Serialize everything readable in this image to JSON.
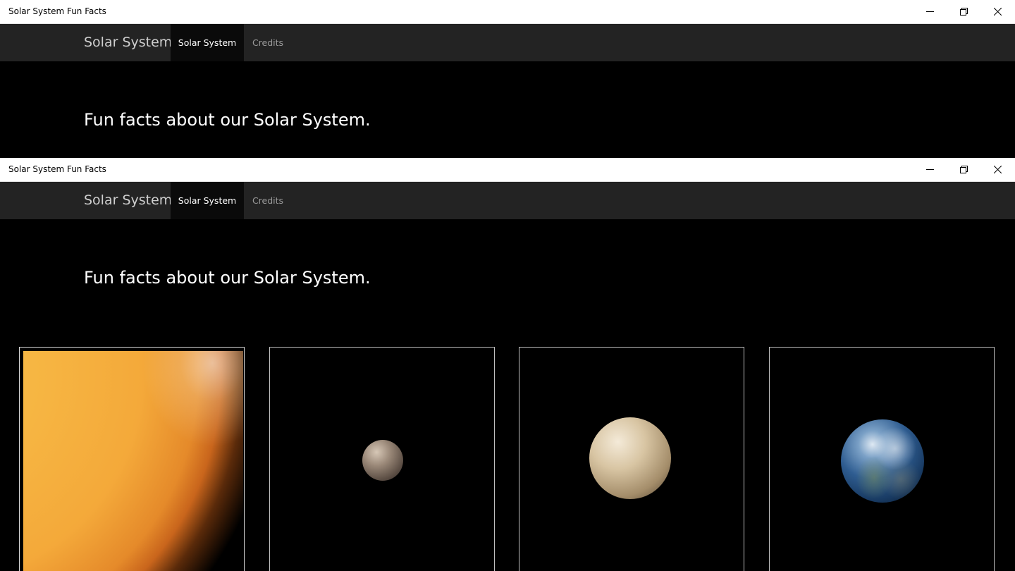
{
  "app": {
    "window_title": "Solar System Fun Facts"
  },
  "nav": {
    "brand": "Solar System",
    "tabs": [
      {
        "label": "Solar System",
        "active": true
      },
      {
        "label": "Credits",
        "active": false
      }
    ]
  },
  "main": {
    "heading": "Fun facts about our Solar System."
  },
  "cards": [
    {
      "image": "sun"
    },
    {
      "image": "mercury"
    },
    {
      "image": "venus"
    },
    {
      "image": "earth"
    }
  ],
  "icons": {
    "minimize": "minimize-icon",
    "maximize": "restore-icon",
    "close": "close-icon"
  },
  "colors": {
    "titlebar_bg": "#ffffff",
    "nav_bg": "#232323",
    "active_tab_bg": "#0a0a0a",
    "page_bg": "#000000"
  }
}
